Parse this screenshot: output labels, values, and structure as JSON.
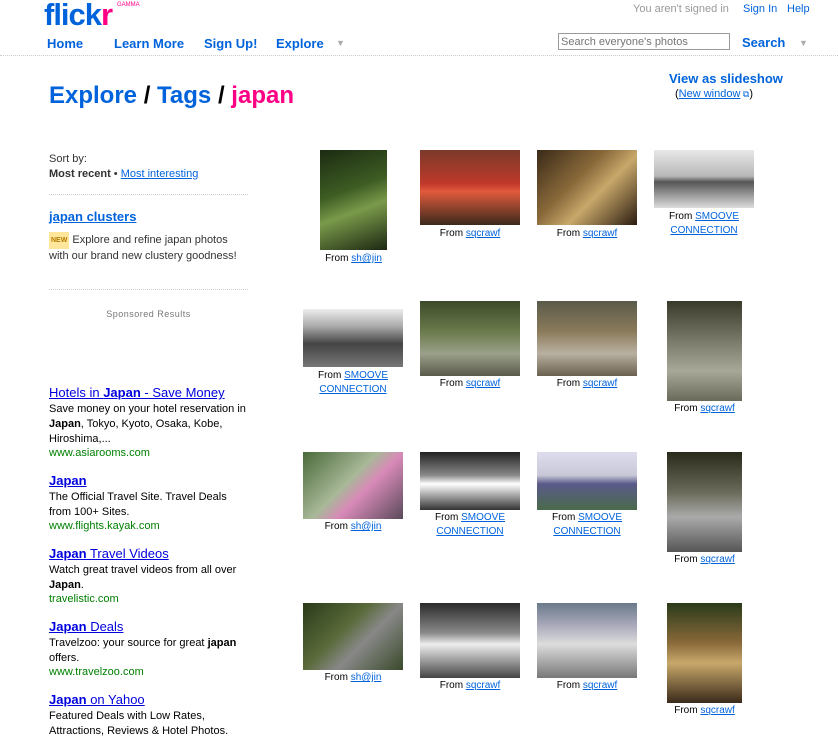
{
  "header": {
    "logo_text": "flick",
    "logo_r": "r",
    "gamma": "GAMMA",
    "signed_status": "You aren't signed in",
    "sign_in": "Sign In",
    "help": "Help",
    "nav": [
      "Home",
      "Learn More",
      "Sign Up!",
      "Explore"
    ],
    "search_placeholder": "Search everyone's photos",
    "search_button": "Search"
  },
  "breadcrumb": {
    "part1": "Explore",
    "sep1": " / ",
    "part2": "Tags",
    "sep2": " / ",
    "tag": "japan"
  },
  "slideshow": {
    "label": "View as slideshow",
    "paren_open": "(",
    "new_window": "New window",
    "paren_close": ")"
  },
  "sidebar": {
    "sort_by": "Sort by:",
    "most_recent": "Most recent",
    "bullet": " • ",
    "most_interesting": "Most interesting",
    "clusters_title": "japan clusters",
    "new_badge": "NEW",
    "clusters_desc": " Explore and refine japan photos with our brand new clustery goodness!",
    "sponsored": "Sponsored Results",
    "ads": [
      {
        "title_pre": "Hotels in ",
        "title_bold": "Japan",
        "title_post": " - Save Money",
        "desc_html": "Save money on your hotel reservation in <b>Japan</b>, Tokyo, Kyoto, Osaka, Kobe, Hiroshima,...",
        "url": "www.asiarooms.com"
      },
      {
        "title_pre": "",
        "title_bold": "Japan",
        "title_post": "",
        "desc_html": "The Official Travel Site. Travel Deals from 100+ Sites.",
        "url": "www.flights.kayak.com"
      },
      {
        "title_pre": "",
        "title_bold": "Japan",
        "title_post": " Travel Videos",
        "desc_html": "Watch great travel videos from all over <b>Japan</b>.",
        "url": "travelistic.com"
      },
      {
        "title_pre": "",
        "title_bold": "Japan",
        "title_post": " Deals",
        "desc_html": "Travelzoo: your source for great <b>japan</b> offers.",
        "url": "www.travelzoo.com"
      },
      {
        "title_pre": "",
        "title_bold": "Japan",
        "title_post": " on Yahoo",
        "desc_html": "Featured Deals with Low Rates, Attractions, Reviews &amp; Hotel Photos.",
        "url": ""
      }
    ]
  },
  "photos_from_label": "From",
  "photos": [
    {
      "owner": "sh@jin",
      "owner2": "",
      "desc": "white flowers on green"
    },
    {
      "owner": "sqcrawf",
      "owner2": "",
      "desc": "red shrine"
    },
    {
      "owner": "sqcrawf",
      "owner2": "",
      "desc": "wooden ema plaques"
    },
    {
      "owner": "SMOOVE",
      "owner2": "CONNECTION",
      "desc": "car by lake bw"
    },
    {
      "owner": "SMOOVE",
      "owner2": "CONNECTION",
      "desc": "mountains bw"
    },
    {
      "owner": "sqcrawf",
      "owner2": "",
      "desc": "torii in forest"
    },
    {
      "owner": "sqcrawf",
      "owner2": "",
      "desc": "wooden shelter"
    },
    {
      "owner": "sqcrawf",
      "owner2": "",
      "desc": "stone lion statue"
    },
    {
      "owner": "sh@jin",
      "owner2": "",
      "desc": "cherry blossoms"
    },
    {
      "owner": "SMOOVE",
      "owner2": "CONNECTION",
      "desc": "road bw"
    },
    {
      "owner": "SMOOVE",
      "owner2": "CONNECTION",
      "desc": "car by water"
    },
    {
      "owner": "sqcrawf",
      "owner2": "",
      "desc": "komainu statue"
    },
    {
      "owner": "sh@jin",
      "owner2": "",
      "desc": "garden pond"
    },
    {
      "owner": "sqcrawf",
      "owner2": "",
      "desc": "stone marker sign"
    },
    {
      "owner": "sqcrawf",
      "owner2": "",
      "desc": "temple building"
    },
    {
      "owner": "sqcrawf",
      "owner2": "",
      "desc": "wooden sign board"
    }
  ],
  "colors": {
    "flickr_blue": "#0063dc",
    "flickr_pink": "#ff0084",
    "ad_link": "#0000de",
    "ad_url": "#008000"
  }
}
